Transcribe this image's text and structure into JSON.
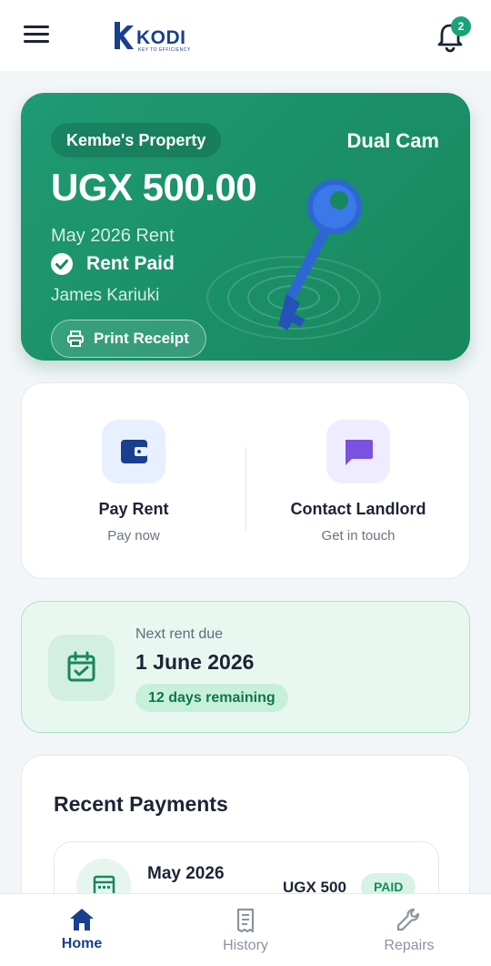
{
  "header": {
    "logo_text": "KODI",
    "logo_tagline": "KEY TO EFFICIENCY",
    "notification_count": "2"
  },
  "hero": {
    "property": "Kembe's  Property",
    "unit": "Dual Cam",
    "amount": "UGX 500.00",
    "period": "May 2026 Rent",
    "status": "Rent Paid",
    "tenant": "James Kariuki",
    "receipt_label": "Print Receipt"
  },
  "actions": [
    {
      "title": "Pay Rent",
      "subtitle": "Pay now",
      "icon": "wallet-icon"
    },
    {
      "title": "Contact Landlord",
      "subtitle": "Get in touch",
      "icon": "chat-icon"
    }
  ],
  "due": {
    "label": "Next rent due",
    "date": "1 June 2026",
    "remaining": "12 days remaining"
  },
  "recent": {
    "title": "Recent Payments",
    "items": [
      {
        "month": "May 2026",
        "amount": "UGX 500",
        "status": "PAID"
      }
    ]
  },
  "nav": [
    {
      "label": "Home",
      "icon": "home-icon",
      "active": true
    },
    {
      "label": "History",
      "icon": "receipt-icon",
      "active": false
    },
    {
      "label": "Repairs",
      "icon": "wrench-icon",
      "active": false
    }
  ],
  "colors": {
    "brand": "#1a3f8f",
    "accent_green": "#1f9a72",
    "background": "#f3f6f9"
  }
}
